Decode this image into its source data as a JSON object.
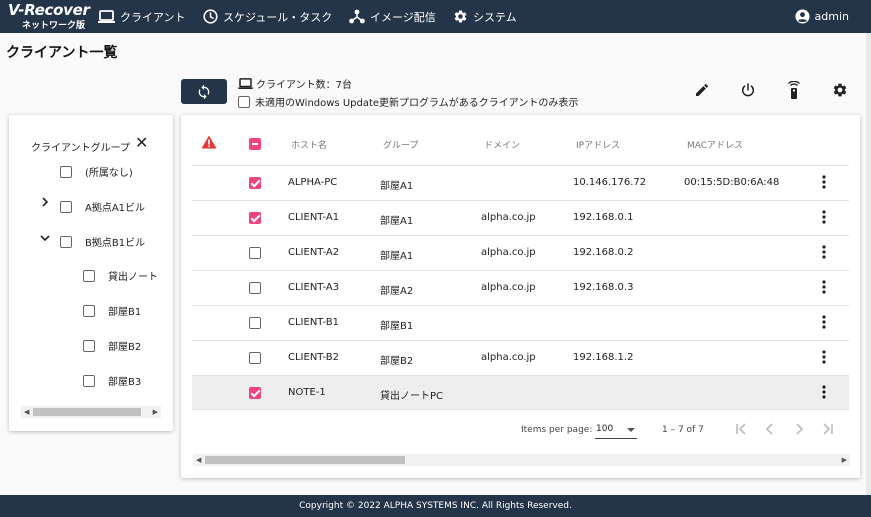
{
  "app": {
    "logo_main": "V-Recover",
    "logo_sub": "ネットワーク版"
  },
  "nav": {
    "client": "クライアント",
    "schedule": "スケジュール・タスク",
    "image": "イメージ配信",
    "system": "システム",
    "user": "admin"
  },
  "page": {
    "title": "クライアント一覧"
  },
  "toolbar": {
    "client_count": "クライアント数：7台",
    "filter_label": "未適用のWindows Update更新プログラムがあるクライアントのみ表示",
    "filter_checked": false
  },
  "sidepanel": {
    "title": "クライアントグループ",
    "close_glyph": "✕",
    "items": [
      {
        "label": "(所属なし)",
        "level": 0,
        "expand": ""
      },
      {
        "label": "A拠点A1ビル",
        "level": 0,
        "expand": "›"
      },
      {
        "label": "B拠点B1ビル",
        "level": 0,
        "expand": "⌄"
      },
      {
        "label": "貸出ノート",
        "level": 1,
        "expand": ""
      },
      {
        "label": "部屋B1",
        "level": 1,
        "expand": ""
      },
      {
        "label": "部屋B2",
        "level": 1,
        "expand": ""
      },
      {
        "label": "部屋B3",
        "level": 1,
        "expand": ""
      }
    ]
  },
  "table": {
    "headers": {
      "host": "ホスト名",
      "group": "グループ",
      "domain": "ドメイン",
      "ip": "IPアドレス",
      "mac": "MACアドレス"
    },
    "rows": [
      {
        "checked": true,
        "host": "ALPHA-PC",
        "group": "部屋A1",
        "domain": "",
        "ip": "10.146.176.72",
        "mac": "00:15:5D:B0:6A:48"
      },
      {
        "checked": true,
        "host": "CLIENT-A1",
        "group": "部屋A1",
        "domain": "alpha.co.jp",
        "ip": "192.168.0.1",
        "mac": ""
      },
      {
        "checked": false,
        "host": "CLIENT-A2",
        "group": "部屋A1",
        "domain": "alpha.co.jp",
        "ip": "192.168.0.2",
        "mac": ""
      },
      {
        "checked": false,
        "host": "CLIENT-A3",
        "group": "部屋A2",
        "domain": "alpha.co.jp",
        "ip": "192.168.0.3",
        "mac": ""
      },
      {
        "checked": false,
        "host": "CLIENT-B1",
        "group": "部屋B1",
        "domain": "",
        "ip": "",
        "mac": ""
      },
      {
        "checked": false,
        "host": "CLIENT-B2",
        "group": "部屋B2",
        "domain": "alpha.co.jp",
        "ip": "192.168.1.2",
        "mac": ""
      },
      {
        "checked": true,
        "host": "NOTE-1",
        "group": "貸出ノートPC",
        "domain": "",
        "ip": "",
        "mac": ""
      }
    ]
  },
  "pager": {
    "items_per_page_label": "Items per page:",
    "page_size": "100",
    "range": "1 – 7 of 7"
  },
  "footer": {
    "copyright": "Copyright © 2022 ALPHA SYSTEMS INC. All Rights Reserved."
  },
  "colors": {
    "header_bg": "#243449",
    "accent_pink": "#f0457a",
    "warning_red": "#e53935"
  }
}
